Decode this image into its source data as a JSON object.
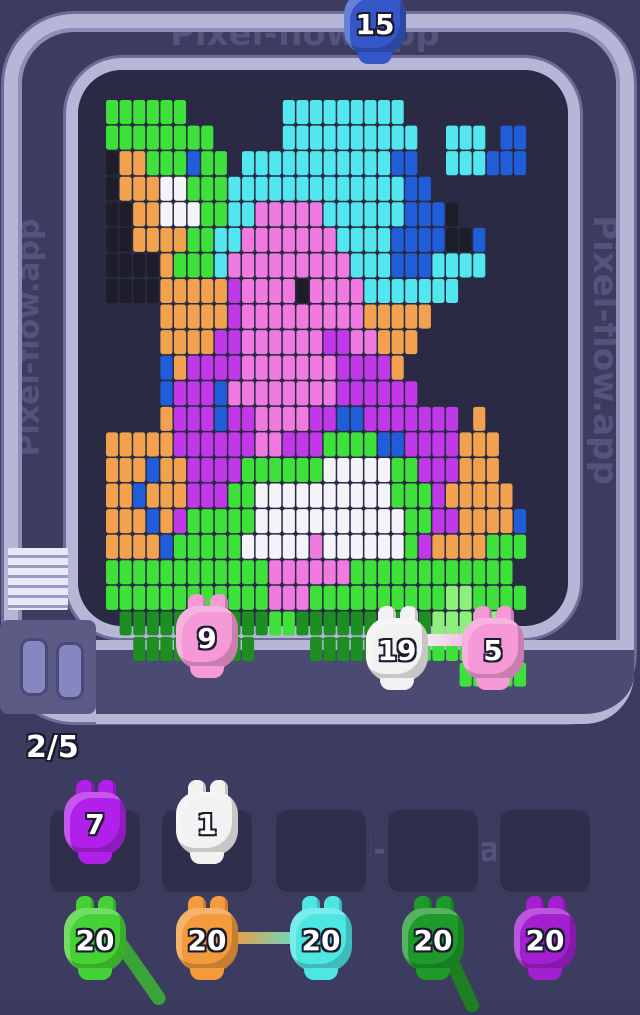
{
  "watermark": "Pixel-flow.app",
  "top_pig": {
    "count": "15",
    "color": "#3557c8"
  },
  "progress": {
    "label": "2/5"
  },
  "conveyor_pigs": [
    {
      "count": "9",
      "color": "#f59ad6"
    },
    {
      "count": "19",
      "color": "#f2f2f2"
    },
    {
      "count": "5",
      "color": "#f59ad6"
    }
  ],
  "queue_slots": [
    {
      "count": "7",
      "color": "#b020e8"
    },
    {
      "count": "1",
      "color": "#f2f2f2"
    },
    {
      "count": "",
      "color": ""
    },
    {
      "count": "",
      "color": ""
    },
    {
      "count": "",
      "color": ""
    }
  ],
  "bottom_pigs": [
    {
      "count": "20",
      "color": "#46d236"
    },
    {
      "count": "20",
      "color": "#f29a3c"
    },
    {
      "count": "20",
      "color": "#4ee6e2"
    },
    {
      "count": "20",
      "color": "#1f9a2a"
    },
    {
      "count": "20",
      "color": "#a31fd0"
    }
  ],
  "palette": {
    "G": "#3ee03a",
    "D": "#1d8f22",
    "K": "#1e1e2a",
    "O": "#f2a24e",
    "W": "#f4f4f8",
    "C": "#52e6ee",
    "B": "#1f5ed8",
    "P": "#f07ae0",
    "M": "#c038e8",
    "V": "#7a22c8",
    "L": "#8cf07a"
  }
}
